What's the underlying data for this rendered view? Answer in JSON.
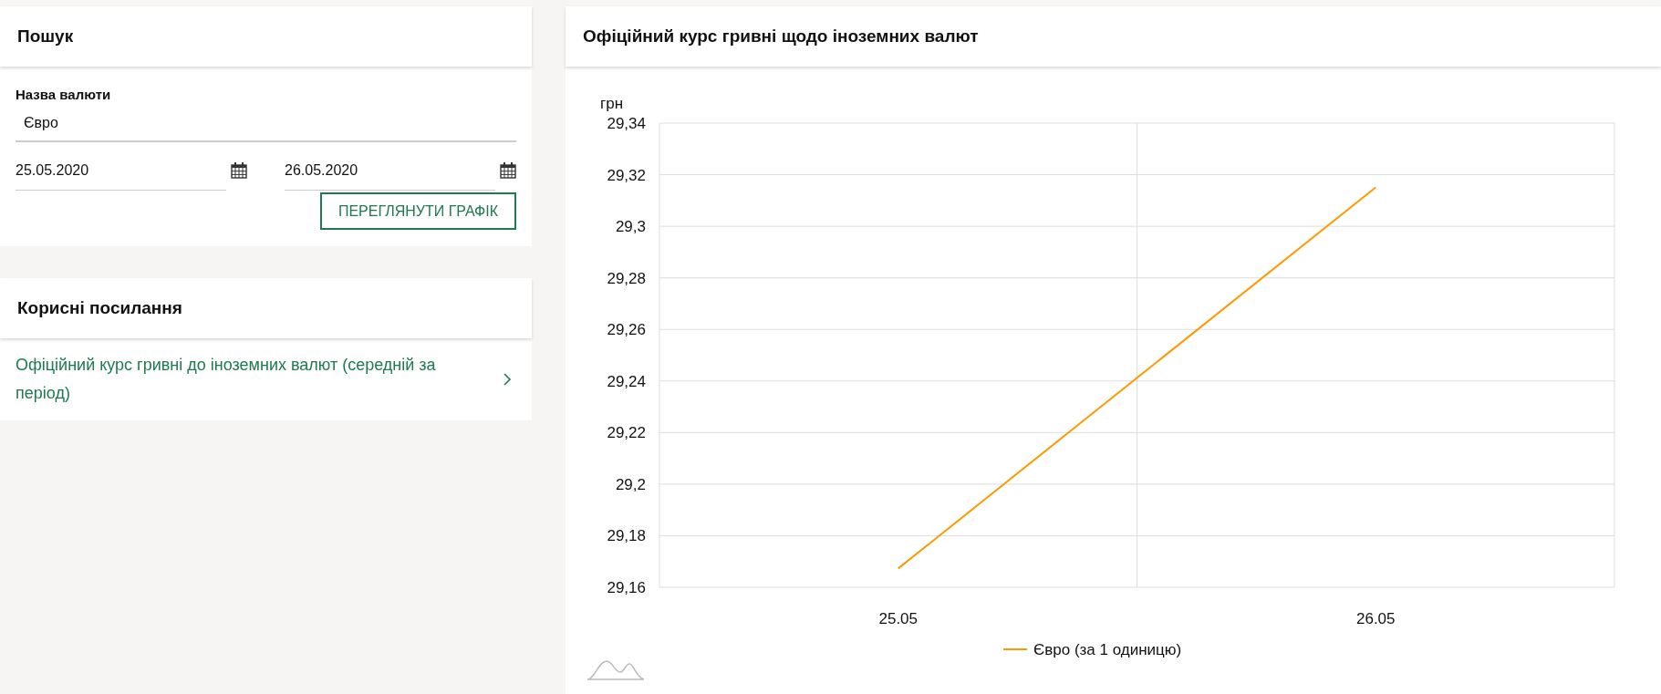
{
  "search": {
    "title": "Пошук",
    "currency_field": {
      "label": "Назва валюти",
      "value": "Євро"
    },
    "date_fields": [
      {
        "value": "25.05.2020"
      },
      {
        "value": "26.05.2020"
      }
    ],
    "submit_button": "ПЕРЕГЛЯНУТИ ГРАФІК"
  },
  "useful_links": {
    "title": "Корисні посилання",
    "links": [
      {
        "text": "Офіційний курс гривні до іноземних валют (середній за період)"
      }
    ]
  },
  "chart_panel": {
    "title": "Офіційний курс гривні щодо іноземних валют",
    "chart_data": {
      "type": "line",
      "ylabel": "грн",
      "categories": [
        "25.05",
        "26.05"
      ],
      "series": [
        {
          "name": "Євро (за 1 одиницю)",
          "color": "#ff9900",
          "values": [
            29.1673,
            29.3151
          ]
        }
      ],
      "ylim": [
        29.16,
        29.34
      ],
      "grid": true,
      "yticks": [
        {
          "value": 29.16,
          "label": "29,16"
        },
        {
          "value": 29.18,
          "label": "29,18"
        },
        {
          "value": 29.2,
          "label": "29,2"
        },
        {
          "value": 29.22,
          "label": "29,22"
        },
        {
          "value": 29.24,
          "label": "29,24"
        },
        {
          "value": 29.26,
          "label": "29,26"
        },
        {
          "value": 29.28,
          "label": "29,28"
        },
        {
          "value": 29.3,
          "label": "29,3"
        },
        {
          "value": 29.32,
          "label": "29,32"
        },
        {
          "value": 29.34,
          "label": "29,34"
        }
      ]
    }
  }
}
